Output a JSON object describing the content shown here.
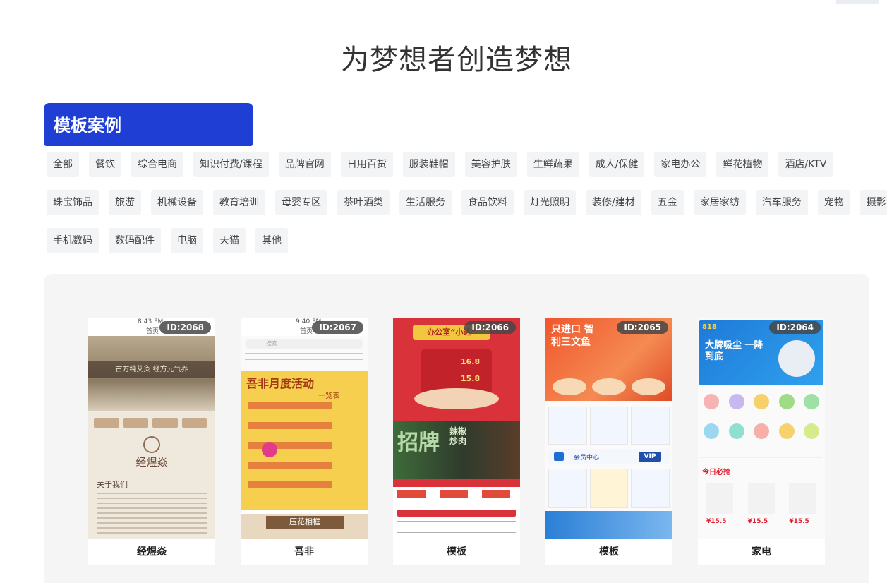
{
  "page": {
    "title": "为梦想者创造梦想"
  },
  "section": {
    "tab_label": "模板案例"
  },
  "categories": {
    "row1": [
      "全部",
      "餐饮",
      "综合电商",
      "知识付费/课程",
      "品牌官网",
      "日用百货",
      "服装鞋帽",
      "美容护肤",
      "生鲜蔬果",
      "成人/保健",
      "家电办公",
      "鲜花植物",
      "酒店/KTV"
    ],
    "row2": [
      "珠宝饰品",
      "旅游",
      "机械设备",
      "教育培训",
      "母婴专区",
      "茶叶酒类",
      "生活服务",
      "食品饮料",
      "灯光照明",
      "装修/建材",
      "五金",
      "家居家纺",
      "汽车服务",
      "宠物",
      "摄影"
    ],
    "row3": [
      "手机数码",
      "数码配件",
      "电脑",
      "天猫",
      "其他"
    ]
  },
  "templates": [
    {
      "id": "ID:2068",
      "name": "经煜焱",
      "status_time": "8:43 PM",
      "status_page": "首页",
      "banner": "古方纯艾灸 经方元气养",
      "brand": "经煜焱",
      "about": "关于我们"
    },
    {
      "id": "ID:2067",
      "name": "吾非",
      "status_time": "9:40 PM",
      "status_page": "首页",
      "search": "搜索",
      "headline": "吾非月度活动",
      "sub": "一览表",
      "footer_title": "压花相框"
    },
    {
      "id": "ID:2066",
      "name": "模板",
      "promo": "办公室“小达”",
      "price1": "16.8",
      "price2": "15.8",
      "sign": "招牌",
      "dish": "辣椒炒肉"
    },
    {
      "id": "ID:2065",
      "name": "模板",
      "headline": "只进口 智利三文鱼",
      "member": "会员中心",
      "vip": "VIP"
    },
    {
      "id": "ID:2064",
      "name": "家电",
      "banner_tag": "818",
      "banner": "大牌吸尘 一降到底",
      "today": "今日必抢",
      "price": "¥15.5"
    }
  ],
  "colors": {
    "accent": "#1f3fd4",
    "chip_bg": "#f3f4f6",
    "gallery_bg": "#f5f5f5"
  }
}
